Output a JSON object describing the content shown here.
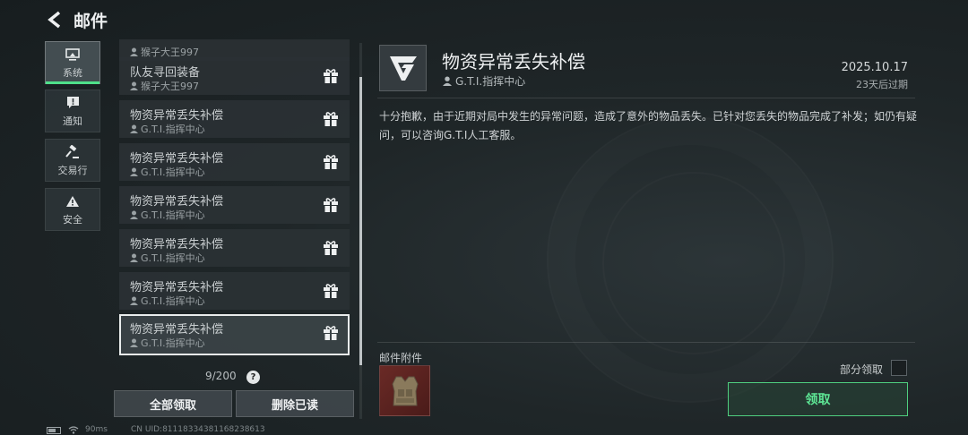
{
  "header": {
    "title": "邮件"
  },
  "categories": [
    {
      "label": "系统",
      "icon": "monitor-icon",
      "active": true
    },
    {
      "label": "通知",
      "icon": "alert-message-icon",
      "active": false
    },
    {
      "label": "交易行",
      "icon": "gavel-icon",
      "active": false
    },
    {
      "label": "安全",
      "icon": "warning-triangle-icon",
      "active": false
    }
  ],
  "mails": [
    {
      "title": "",
      "sender": "猴子大王997",
      "partial": true
    },
    {
      "title": "队友寻回装备",
      "sender": "猴子大王997"
    },
    {
      "title": "物资异常丢失补偿",
      "sender": "G.T.I.指挥中心"
    },
    {
      "title": "物资异常丢失补偿",
      "sender": "G.T.I.指挥中心"
    },
    {
      "title": "物资异常丢失补偿",
      "sender": "G.T.I.指挥中心"
    },
    {
      "title": "物资异常丢失补偿",
      "sender": "G.T.I.指挥中心"
    },
    {
      "title": "物资异常丢失补偿",
      "sender": "G.T.I.指挥中心"
    },
    {
      "title": "物资异常丢失补偿",
      "sender": "G.T.I.指挥中心",
      "selected": true
    }
  ],
  "list_footer": {
    "count": "9/200",
    "help": "?",
    "claim_all": "全部领取",
    "delete_read": "删除已读"
  },
  "detail": {
    "title": "物资异常丢失补偿",
    "sender": "G.T.I.指挥中心",
    "date": "2025.10.17",
    "expire": "23天后过期",
    "body": "十分抱歉，由于近期对局中发生的异常问题，造成了意外的物品丢失。已针对您丢失的物品完成了补发；如仍有疑问，可以咨询G.T.I人工客服。",
    "attachment_label": "邮件附件",
    "attachment_icon": "armor-vest-icon",
    "partial_claim": "部分领取",
    "claim": "领取"
  },
  "status": {
    "ping": "90ms",
    "uid": "CN UID:8111833438116823861​3"
  },
  "colors": {
    "accent": "#4fe08a",
    "claim_text": "#5ee795"
  }
}
